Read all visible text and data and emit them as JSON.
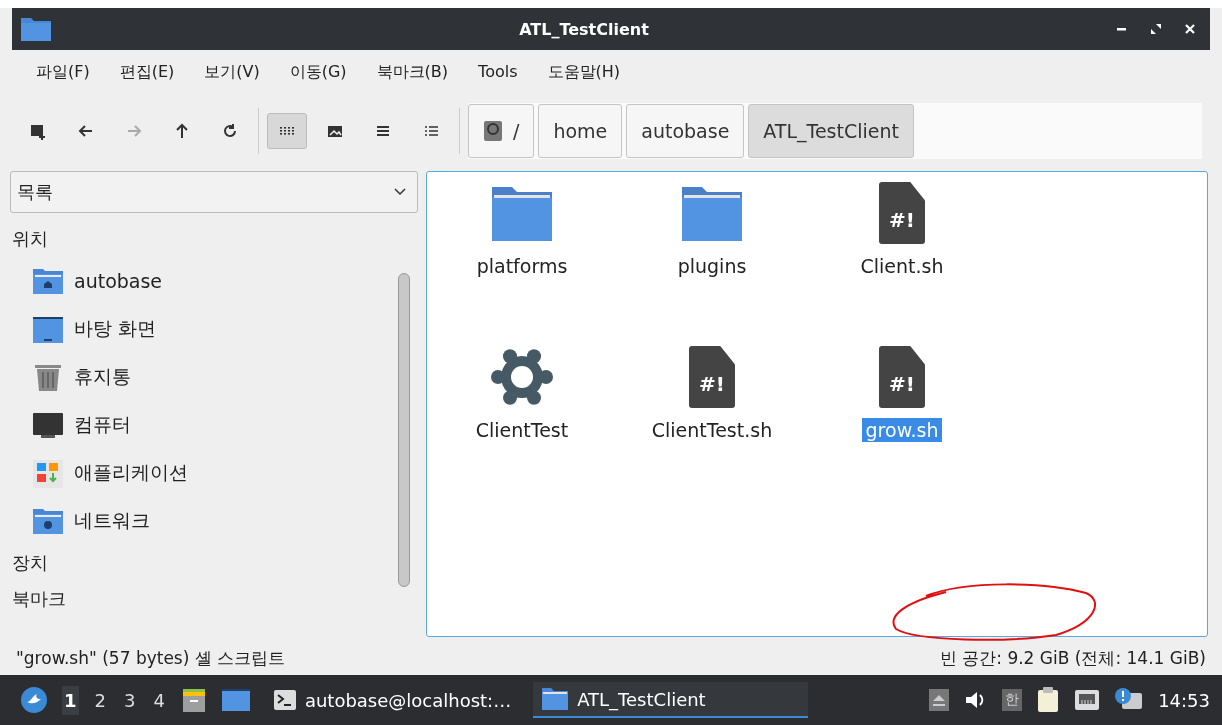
{
  "window": {
    "title": "ATL_TestClient"
  },
  "menu": [
    "파일(F)",
    "편집(E)",
    "보기(V)",
    "이동(G)",
    "북마크(B)",
    "Tools",
    "도움말(H)"
  ],
  "toolbar": [
    {
      "kind": "new-window",
      "disabled": false,
      "selected": false
    },
    {
      "kind": "back",
      "disabled": false,
      "selected": false
    },
    {
      "kind": "forward",
      "disabled": true,
      "selected": false
    },
    {
      "kind": "up",
      "disabled": false,
      "selected": false
    },
    {
      "kind": "reload",
      "disabled": false,
      "selected": false
    },
    {
      "kind": "icon-view",
      "disabled": false,
      "selected": true
    },
    {
      "kind": "thumbnail-view",
      "disabled": false,
      "selected": false
    },
    {
      "kind": "compact-view",
      "disabled": false,
      "selected": false
    },
    {
      "kind": "detail-view",
      "disabled": false,
      "selected": false
    }
  ],
  "path": [
    {
      "label": "/",
      "root": true,
      "selected": false
    },
    {
      "label": "home",
      "root": false,
      "selected": false
    },
    {
      "label": "autobase",
      "root": false,
      "selected": false
    },
    {
      "label": "ATL_TestClient",
      "root": false,
      "selected": true
    }
  ],
  "sidebar": {
    "mode": "목록",
    "sections": [
      {
        "title": "위치",
        "items": [
          {
            "label": "autobase",
            "kind": "home"
          },
          {
            "label": "바탕 화면",
            "kind": "desktop"
          },
          {
            "label": "휴지통",
            "kind": "trash"
          },
          {
            "label": "컴퓨터",
            "kind": "computer"
          },
          {
            "label": "애플리케이션",
            "kind": "apps"
          },
          {
            "label": "네트워크",
            "kind": "network"
          }
        ]
      },
      {
        "title": "장치"
      },
      {
        "title": "북마크"
      }
    ]
  },
  "files": [
    {
      "name": "platforms",
      "kind": "folder",
      "selected": false
    },
    {
      "name": "plugins",
      "kind": "folder",
      "selected": false
    },
    {
      "name": "Client.sh",
      "kind": "script",
      "glyph": "#!",
      "selected": false
    },
    {
      "name": "ClientTest",
      "kind": "executable",
      "selected": false
    },
    {
      "name": "ClientTest.sh",
      "kind": "script",
      "glyph": "#!",
      "selected": false
    },
    {
      "name": "grow.sh",
      "kind": "script",
      "glyph": "#!",
      "selected": true
    }
  ],
  "status_bar": {
    "selection": "\"grow.sh\" (57 bytes) 셸 스크립트",
    "free_space": "빈 공간: 9.2 GiB (전체: 14.1 GiB)"
  },
  "taskbar": {
    "workspaces": [
      {
        "label": "1",
        "selected": true
      },
      {
        "label": "2",
        "selected": false
      },
      {
        "label": "3",
        "selected": false
      },
      {
        "label": "4",
        "selected": false
      }
    ],
    "tasks": [
      {
        "label": "autobase@localhost:…",
        "kind": "terminal",
        "selected": false
      },
      {
        "label": "ATL_TestClient",
        "kind": "folder",
        "selected": true
      }
    ],
    "ime": "한",
    "clock": "14:53"
  }
}
